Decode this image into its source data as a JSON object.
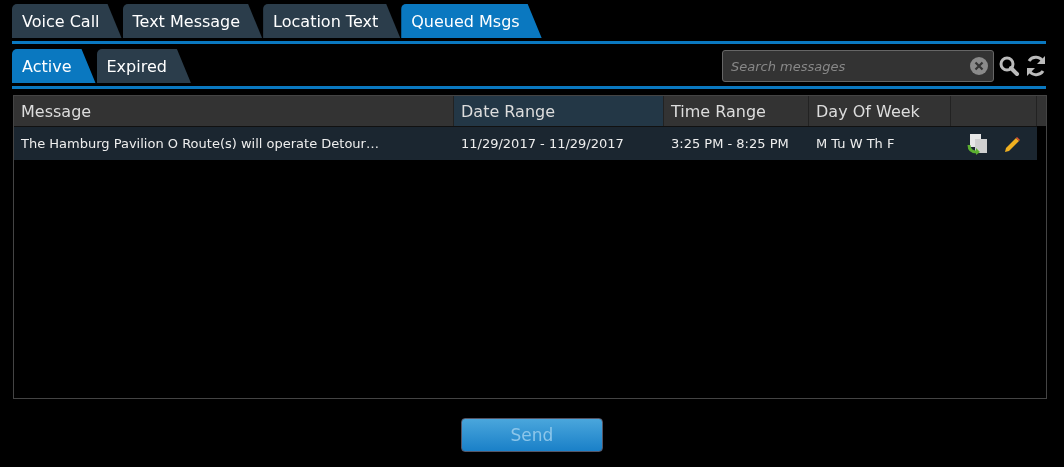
{
  "tabs": [
    {
      "label": "Voice Call",
      "selected": false
    },
    {
      "label": "Text Message",
      "selected": false
    },
    {
      "label": "Location Text",
      "selected": false
    },
    {
      "label": "Queued Msgs",
      "selected": true
    }
  ],
  "subtabs": [
    {
      "label": "Active",
      "selected": true
    },
    {
      "label": "Expired",
      "selected": false
    }
  ],
  "search": {
    "placeholder": "Search messages"
  },
  "table": {
    "columns": [
      {
        "label": "Message",
        "sorted": false
      },
      {
        "label": "Date Range",
        "sorted": true
      },
      {
        "label": "Time Range",
        "sorted": false
      },
      {
        "label": "Day Of Week",
        "sorted": false
      }
    ],
    "rows": [
      {
        "message": "The Hamburg Pavilion O Route(s) will operate Detour…",
        "date_range": "11/29/2017 - 11/29/2017",
        "time_range": "3:25 PM - 8:25 PM",
        "day_of_week": "M Tu W Th F"
      }
    ]
  },
  "send_button": {
    "label": "Send",
    "disabled": true
  }
}
